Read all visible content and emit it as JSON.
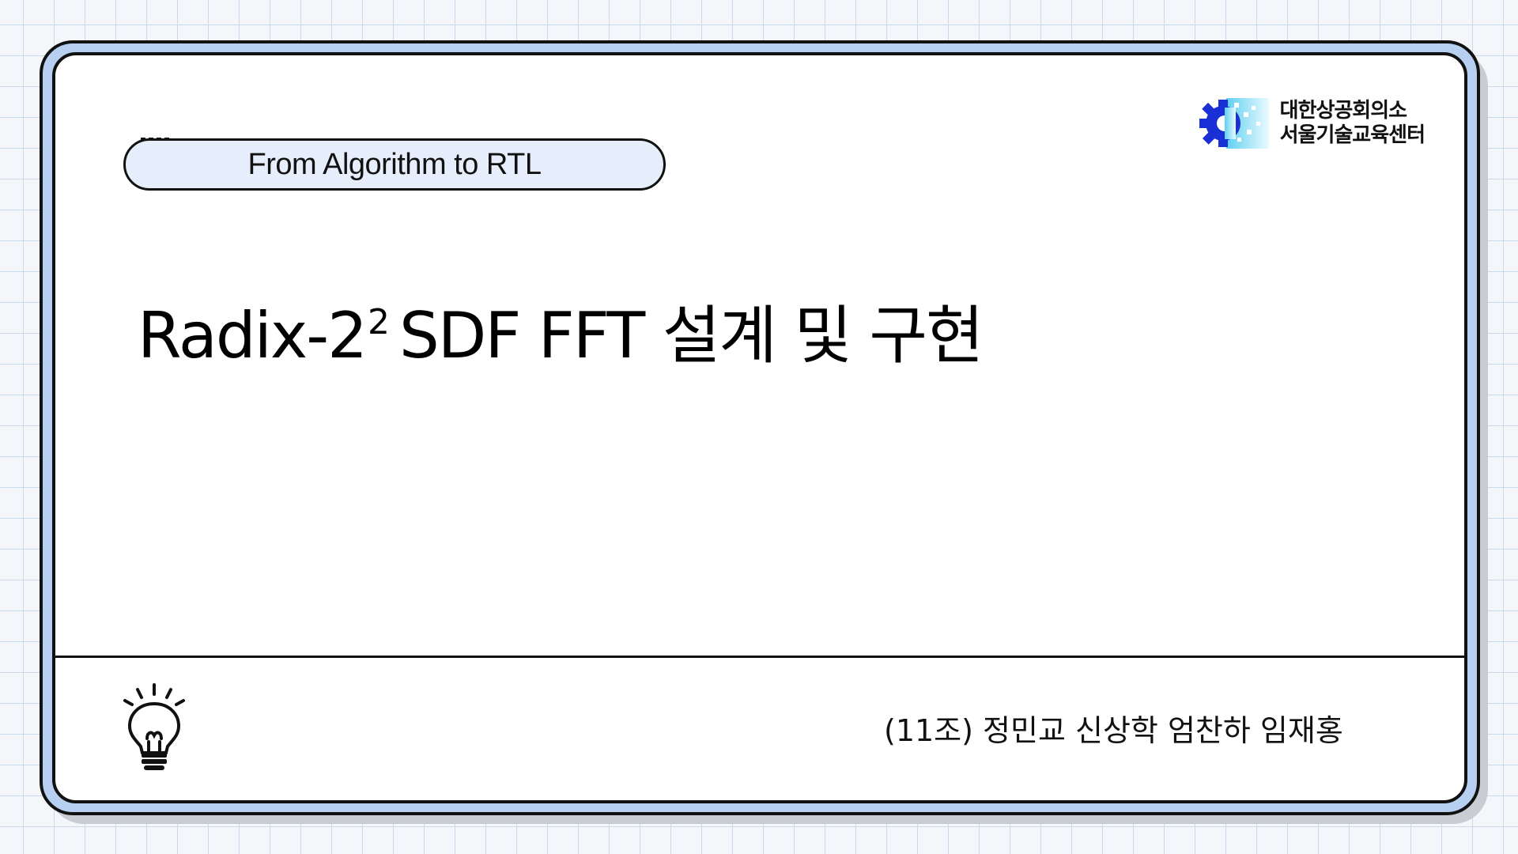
{
  "slide": {
    "tag_label": "From Algorithm to RTL",
    "title_main": "Radix-2",
    "title_sup": "2",
    "title_rest": "SDF FFT 설계 및 구현",
    "logo": {
      "line1": "대한상공회의소",
      "line2": "서울기술교육센터",
      "icon": "gear-icon"
    },
    "members": "(11조)  정민교 신상학 엄찬하 임재홍",
    "footer_icon": "lightbulb-icon"
  },
  "colors": {
    "frame_fill": "#b7cff0",
    "pill_fill": "#e6eefb",
    "grid_line": "#c9d9ee",
    "logo_blue": "#1a2fd6",
    "logo_cyan": "#5fd0f0"
  }
}
